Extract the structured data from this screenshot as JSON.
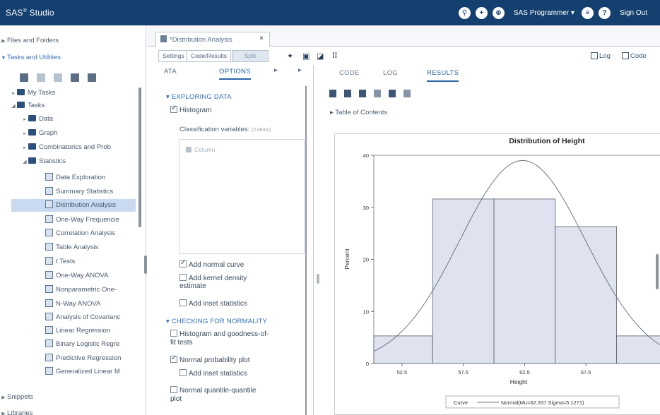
{
  "app": {
    "brand": "SAS",
    "brand_sup": "®",
    "brand_suffix": "Studio"
  },
  "top_bar": {
    "role": "SAS Programmer",
    "role_caret": "▾",
    "sign_out": "Sign Out"
  },
  "nav": {
    "files_and_folders": "Files and Folders",
    "tasks_and_utilities": "Tasks and Utilities",
    "tree": [
      {
        "label": "My Tasks"
      },
      {
        "label": "Tasks"
      },
      {
        "label": "Data"
      },
      {
        "label": "Graph"
      },
      {
        "label": "Combinatorics and Prob"
      },
      {
        "label": "Statistics"
      },
      {
        "label": "Data Exploration"
      },
      {
        "label": "Summary Statistics"
      },
      {
        "label": "Distribution Analysis"
      },
      {
        "label": "One-Way Frequencie"
      },
      {
        "label": "Correlation Analysis"
      },
      {
        "label": "Table Analysis"
      },
      {
        "label": "t Tests"
      },
      {
        "label": "One-Way ANOVA"
      },
      {
        "label": "Nonparametric One-"
      },
      {
        "label": "N-Way ANOVA"
      },
      {
        "label": "Analysis of Covarianc"
      },
      {
        "label": "Linear Regression"
      },
      {
        "label": "Binary Logistic Regre"
      },
      {
        "label": "Predictive Regression"
      },
      {
        "label": "Generalized Linear M"
      }
    ],
    "snippets": "Snippets",
    "libraries": "Libraries"
  },
  "doc_tab": {
    "title": "*Distribution Analysis",
    "close": "×"
  },
  "toolbar": {
    "settings": "Settings",
    "code_results": "Code/Results",
    "split": "Split",
    "log": "Log",
    "code": "Code"
  },
  "options": {
    "tabs": [
      "ATA",
      "OPTIONS"
    ],
    "exploring_header": "▾ EXPLORING DATA",
    "histogram": "Histogram",
    "classification_label": "Classification variables:",
    "classification_count": "(2 items)",
    "classification_item": "Column",
    "add_normal_curve": "Add normal curve",
    "add_kernel_1": "Add kernel density",
    "add_kernel_2": "estimate",
    "add_inset_1": "Add inset statistics",
    "normality_header": "▾ CHECKING FOR NORMALITY",
    "hist_gof_1": "Histogram and goodness-of-",
    "hist_gof_2": "fit tests",
    "normal_prob_plot": "Normal probability plot",
    "add_inset_2": "Add inset statistics",
    "qq_1": "Normal quantile-quantile",
    "qq_2": "plot"
  },
  "results": {
    "tabs": [
      "CODE",
      "LOG",
      "RESULTS"
    ],
    "toc": "▸ Table of Contents"
  },
  "chart_data": {
    "type": "bar",
    "title": "Distribution of Height",
    "xlabel": "Height",
    "ylabel": "Percent",
    "bin_edges": [
      50,
      55,
      60,
      65,
      70,
      75
    ],
    "x_ticks": [
      52.5,
      57.5,
      62.5,
      67.5
    ],
    "x_tick_labels": [
      "52.5",
      "57.5",
      "62.5",
      "67.5"
    ],
    "xlim": [
      50.2,
      73.6
    ],
    "values": [
      5.3,
      31.6,
      31.6,
      26.3,
      5.3
    ],
    "ylim": [
      0,
      40
    ],
    "y_ticks": [
      0,
      10,
      20,
      30,
      40
    ],
    "y_tick_labels": [
      "0",
      "10",
      "20",
      "30",
      "40"
    ],
    "curve": {
      "mu": 62.337,
      "sigma": 5.1271,
      "peak": 39
    },
    "legend": {
      "label": "Curve",
      "entry": "Normal(Mu=62.337 Sigma=5.1271)"
    },
    "colors": {
      "bar_fill": "#dee3ef",
      "bar_stroke": "#555d6b",
      "curve": "#6f7683"
    }
  }
}
